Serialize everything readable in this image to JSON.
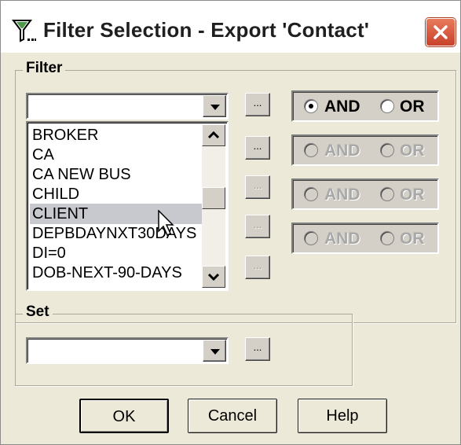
{
  "window": {
    "title": "Filter Selection - Export 'Contact'"
  },
  "filter_group": {
    "label": "Filter",
    "combo_value": "",
    "dots_label": "...",
    "list_items": [
      "BROKER",
      "CA",
      "CA NEW BUS",
      "CHILD",
      "CLIENT",
      "DEPBDAYNXT30DAYS",
      "DI=0",
      "DOB-NEXT-90-DAYS"
    ],
    "selected_item": "CLIENT",
    "logic_rows": [
      {
        "and": "AND",
        "or": "OR",
        "selected": "AND",
        "enabled": true
      },
      {
        "and": "AND",
        "or": "OR",
        "selected": "",
        "enabled": false
      },
      {
        "and": "AND",
        "or": "OR",
        "selected": "",
        "enabled": false
      },
      {
        "and": "AND",
        "or": "OR",
        "selected": "",
        "enabled": false
      }
    ]
  },
  "set_group": {
    "label": "Set",
    "combo_value": "",
    "dots_label": "..."
  },
  "buttons": {
    "ok": "OK",
    "cancel": "Cancel",
    "help": "Help"
  },
  "icons": {
    "title_icon": "filter-funnel-icon",
    "close": "close-icon"
  },
  "colors": {
    "dialog_bg": "#ece9d8",
    "close_button": "#d9583b",
    "selection": "#c8c8cf"
  }
}
